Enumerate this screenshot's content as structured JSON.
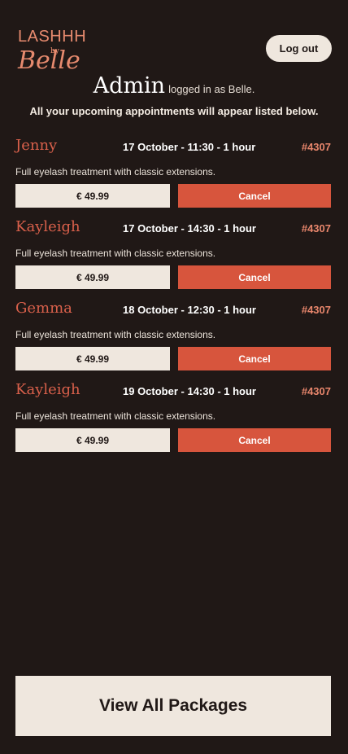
{
  "brand": {
    "line1": "LASHHH",
    "line2": "by",
    "line3": "Belle"
  },
  "header": {
    "logout_label": "Log out"
  },
  "intro": {
    "title": "Admin",
    "logged_in": "logged in as Belle.",
    "subtitle": "All your upcoming appointments will appear listed below."
  },
  "appointments": [
    {
      "name": "Jenny",
      "when": "17 October - 11:30 - 1 hour",
      "ref": "#4307",
      "description": "Full eyelash treatment with classic extensions.",
      "price": "€ 49.99",
      "cancel_label": "Cancel"
    },
    {
      "name": "Kayleigh",
      "when": "17 October - 14:30 - 1 hour",
      "ref": "#4307",
      "description": "Full eyelash treatment with classic extensions.",
      "price": "€ 49.99",
      "cancel_label": "Cancel"
    },
    {
      "name": "Gemma",
      "when": "18 October - 12:30 - 1 hour",
      "ref": "#4307",
      "description": "Full eyelash treatment with classic extensions.",
      "price": "€ 49.99",
      "cancel_label": "Cancel"
    },
    {
      "name": "Kayleigh",
      "when": "19 October - 14:30 - 1 hour",
      "ref": "#4307",
      "description": "Full eyelash treatment with classic extensions.",
      "price": "€ 49.99",
      "cancel_label": "Cancel"
    }
  ],
  "footer": {
    "view_all_label": "View All Packages"
  },
  "colors": {
    "background": "#201816",
    "accent": "#d7553d",
    "cream": "#efe7de"
  }
}
